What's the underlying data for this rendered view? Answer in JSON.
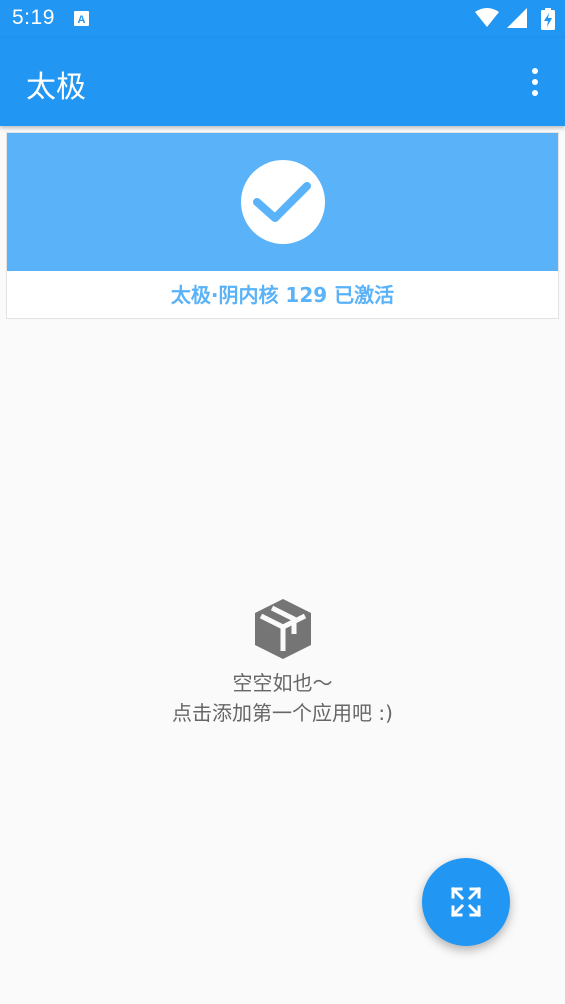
{
  "status_bar": {
    "time": "5:19",
    "notification_icon": "a-box-icon",
    "icons": [
      "wifi-icon",
      "signal-icon",
      "battery-charging-icon"
    ]
  },
  "app_bar": {
    "title": "太极",
    "menu_icon": "more-vert-icon"
  },
  "status_card": {
    "icon": "check-icon",
    "text": "太极·阴内核 129 已激活",
    "banner_color": "#5AB2F8"
  },
  "empty_state": {
    "icon": "package-icon",
    "line1": "空空如也～",
    "line2": "点击添加第一个应用吧 :)"
  },
  "fab": {
    "icon": "expand-arrows-icon"
  },
  "colors": {
    "primary": "#2196F3",
    "accent_light": "#5AB2F8",
    "background": "#fafafa"
  }
}
